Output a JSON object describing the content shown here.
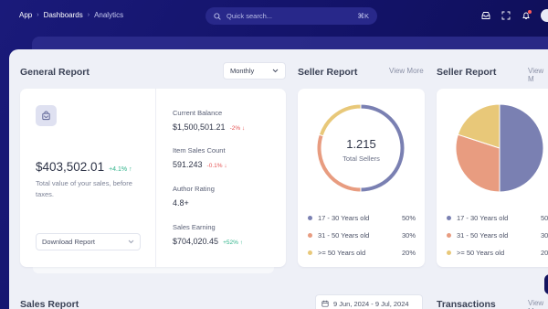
{
  "breadcrumb": {
    "items": [
      "App",
      "Dashboards"
    ],
    "current": "Analytics"
  },
  "search": {
    "placeholder": "Quick search...",
    "shortcut": "⌘K"
  },
  "general_report": {
    "title": "General Report",
    "period": "Monthly",
    "total": "$403,502.01",
    "total_change": "+4.1% ↑",
    "description": "Total value of your sales, before taxes.",
    "download_label": "Download Report",
    "stats": [
      {
        "label": "Current Balance",
        "value": "$1,500,501.21",
        "change": "-2% ↓",
        "trend": "neg"
      },
      {
        "label": "Item Sales Count",
        "value": "591.243",
        "change": "-0.1% ↓",
        "trend": "neg"
      },
      {
        "label": "Author Rating",
        "value": "4.8+",
        "change": "",
        "trend": ""
      },
      {
        "label": "Sales Earning",
        "value": "$704,020.45",
        "change": "+52% ↑",
        "trend": "pos"
      }
    ]
  },
  "seller_report_1": {
    "title": "Seller Report",
    "view_more": "View More",
    "center_value": "1.215",
    "center_label": "Total Sellers",
    "legend": [
      {
        "label": "17 - 30 Years old",
        "pct": "50%",
        "color": "#7a80b2"
      },
      {
        "label": "31 - 50 Years old",
        "pct": "30%",
        "color": "#e89c80"
      },
      {
        "label": ">= 50 Years old",
        "pct": "20%",
        "color": "#e8c879"
      }
    ]
  },
  "seller_report_2": {
    "title": "Seller Report",
    "view_more": "View M",
    "legend": [
      {
        "label": "17 - 30 Years old",
        "pct": "50%",
        "color": "#7a80b2"
      },
      {
        "label": "31 - 50 Years old",
        "pct": "30%",
        "color": "#e89c80"
      },
      {
        "label": ">= 50 Years old",
        "pct": "20%",
        "color": "#e8c879"
      }
    ]
  },
  "chart_data": [
    {
      "type": "pie",
      "variant": "donut",
      "categories": [
        "17 - 30 Years old",
        "31 - 50 Years old",
        ">= 50 Years old"
      ],
      "values": [
        50,
        30,
        20
      ]
    },
    {
      "type": "pie",
      "categories": [
        "17 - 30 Years old",
        "31 - 50 Years old",
        ">= 50 Years old"
      ],
      "values": [
        50,
        30,
        20
      ]
    }
  ],
  "sales_report": {
    "title": "Sales Report",
    "date_range": "9 Jun, 2024 - 9 Jul, 2024"
  },
  "transactions": {
    "title": "Transactions",
    "view_more": "View M"
  }
}
